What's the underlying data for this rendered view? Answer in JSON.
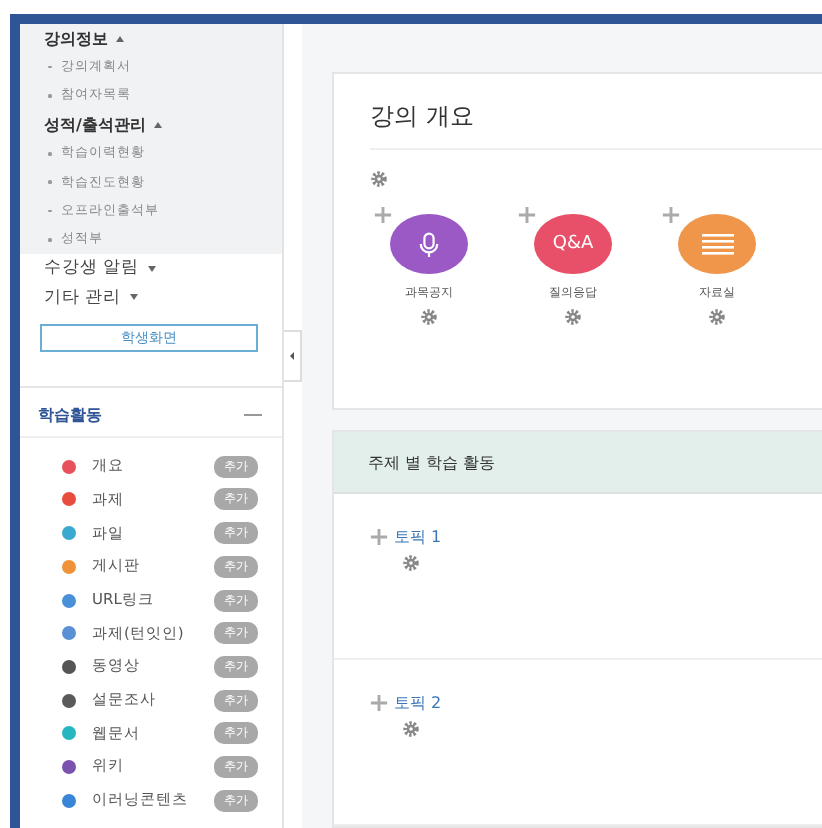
{
  "sidebar": {
    "menu": [
      {
        "label": "강의정보",
        "expanded": true,
        "children": [
          {
            "label": "강의계획서"
          },
          {
            "label": "참여자목록"
          }
        ]
      },
      {
        "label": "성적/출석관리",
        "expanded": true,
        "children": [
          {
            "label": "학습이력현황"
          },
          {
            "label": "학습진도현황"
          },
          {
            "label": "오프라인출석부"
          },
          {
            "label": "성적부"
          }
        ]
      },
      {
        "label": "수강생 알림",
        "expanded": false
      },
      {
        "label": "기타 관리",
        "expanded": false
      }
    ],
    "student_view_button": "학생화면",
    "activities": {
      "title": "학습활동",
      "items": [
        {
          "label": "개요",
          "color": "#e8505b",
          "action": "추가"
        },
        {
          "label": "과제",
          "color": "#e84c3d",
          "action": "추가"
        },
        {
          "label": "파일",
          "color": "#3aa9d0",
          "action": "추가"
        },
        {
          "label": "게시판",
          "color": "#f0923a",
          "action": "추가"
        },
        {
          "label": "URL링크",
          "color": "#4a90d9",
          "action": "추가"
        },
        {
          "label": "과제(턴잇인)",
          "color": "#5b8fd6",
          "action": "추가"
        },
        {
          "label": "동영상",
          "color": "#555555",
          "action": "추가"
        },
        {
          "label": "설문조사",
          "color": "#5a5a5a",
          "action": "추가"
        },
        {
          "label": "웹문서",
          "color": "#26b6c0",
          "action": "추가"
        },
        {
          "label": "위키",
          "color": "#7b52b0",
          "action": "추가"
        },
        {
          "label": "이러닝콘텐츠",
          "color": "#3a86d6",
          "action": "추가"
        }
      ]
    }
  },
  "main": {
    "overview": {
      "title": "강의 개요",
      "tiles": [
        {
          "label": "과목공지",
          "kind": "mic",
          "color": "#9b59c6"
        },
        {
          "label": "질의응답",
          "kind": "badge",
          "badge": "Q&A",
          "color": "#e8506a"
        },
        {
          "label": "자료실",
          "kind": "list",
          "color": "#f0964a"
        }
      ]
    },
    "topics": {
      "title": "주제 별 학습 활동",
      "items": [
        {
          "label": "토픽 1"
        },
        {
          "label": "토픽 2"
        }
      ]
    }
  }
}
